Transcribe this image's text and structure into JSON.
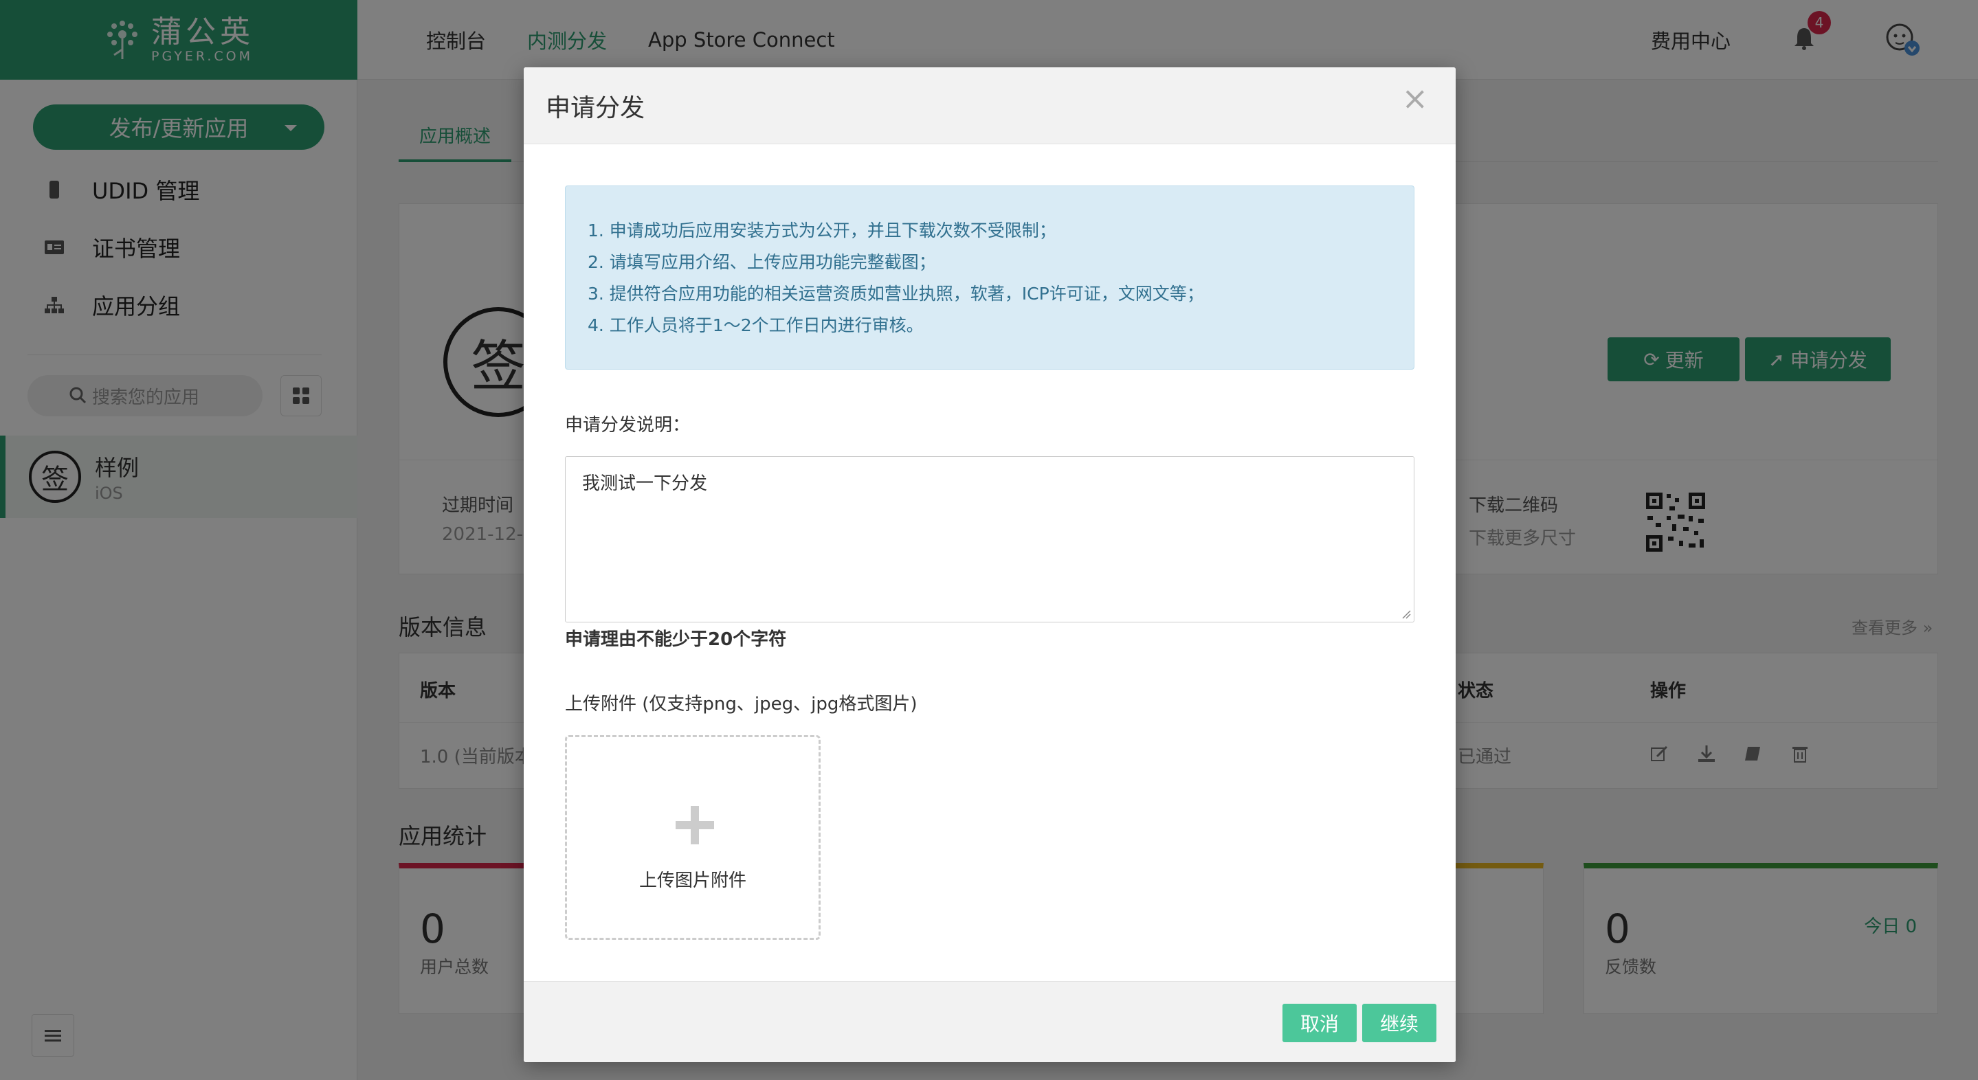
{
  "brand": {
    "name_cn": "蒲公英",
    "name_en": "PGYER.COM",
    "color": "#2d9d71"
  },
  "topnav": {
    "items": [
      {
        "label": "控制台"
      },
      {
        "label": "内测分发",
        "active": true
      },
      {
        "label": "App Store Connect"
      }
    ],
    "billing": "费用中心",
    "notification_count": "4"
  },
  "sidebar": {
    "publish_label": "发布/更新应用",
    "items": [
      {
        "label": "UDID 管理",
        "icon": "device-icon"
      },
      {
        "label": "证书管理",
        "icon": "id-card-icon"
      },
      {
        "label": "应用分组",
        "icon": "sitemap-icon"
      }
    ],
    "search_placeholder": "搜索您的应用",
    "app": {
      "logo_char": "签",
      "name": "样例",
      "platform": "iOS"
    }
  },
  "main": {
    "tab": "应用概述",
    "logo_char": "签",
    "update_button": "更新",
    "apply_button": "申请分发",
    "expire_label": "过期时间",
    "expire_value": "2021-12-",
    "qr_label": "下载二维码",
    "qr_sub": "下载更多尺寸",
    "version_section": "版本信息",
    "more_link": "查看更多 »",
    "table": {
      "headers": [
        "版本",
        "状态",
        "操作"
      ],
      "row": {
        "version": "1.0 (当前版本",
        "status": "已通过"
      }
    },
    "stats_section": "应用统计",
    "stats": [
      {
        "value": "0",
        "label": "用户总数",
        "color": "#d9264a"
      },
      {
        "value": "0",
        "label": "反馈数",
        "today": "今日 0",
        "color": "#3d9a3a"
      }
    ],
    "stat_accent_middle": "#e8b623"
  },
  "modal": {
    "title": "申请分发",
    "close": "×",
    "notice": [
      "1. 申请成功后应用安装方式为公开，并且下载次数不受限制；",
      "2. 请填写应用介绍、上传应用功能完整截图；",
      "3. 提供符合应用功能的相关运营资质如营业执照，软著，ICP许可证，文网文等；",
      "4. 工作人员将于1～2个工作日内进行审核。"
    ],
    "desc_label": "申请分发说明：",
    "desc_value": "我测试一下分发",
    "hint": "申请理由不能少于20个字符",
    "upload_label": "上传附件 (仅支持png、jpeg、jpg格式图片)",
    "upload_button": "上传图片附件",
    "cancel": "取消",
    "continue": "继续"
  }
}
